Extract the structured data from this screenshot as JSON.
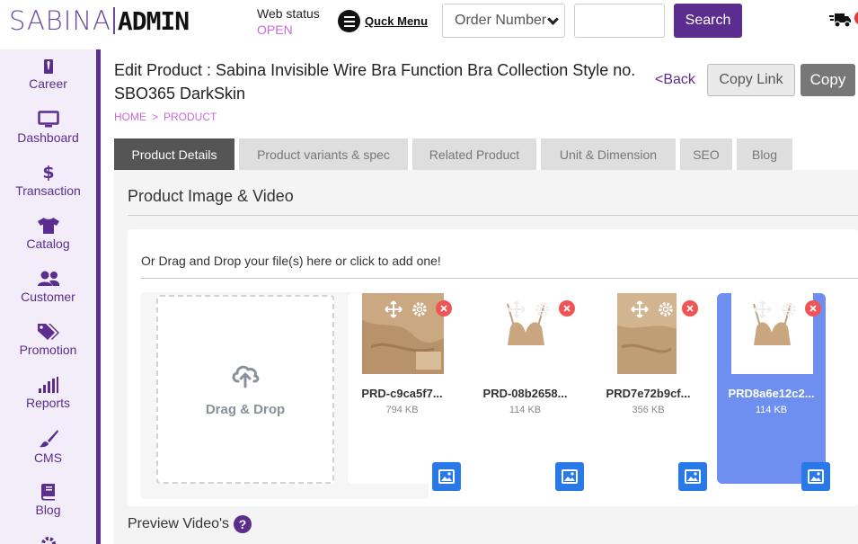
{
  "header": {
    "logo_left": "SABINA",
    "logo_right": "ADMIN",
    "web_status_label": "Web status",
    "web_status_value": "OPEN",
    "quick_menu_label": "Quck Menu",
    "order_select_value": "Order Number",
    "search_input_value": "",
    "search_button_label": "Search",
    "truck_icon": "truck-icon"
  },
  "sidebar": {
    "items": [
      {
        "label": "Career",
        "icon": "tie-icon"
      },
      {
        "label": "Dashboard",
        "icon": "monitor-icon"
      },
      {
        "label": "Transaction",
        "icon": "dollar-icon"
      },
      {
        "label": "Catalog",
        "icon": "shirt-icon"
      },
      {
        "label": "Customer",
        "icon": "users-icon"
      },
      {
        "label": "Promotion",
        "icon": "tags-icon"
      },
      {
        "label": "Reports",
        "icon": "signal-icon"
      },
      {
        "label": "CMS",
        "icon": "brush-icon"
      },
      {
        "label": "Blog",
        "icon": "book-icon"
      }
    ]
  },
  "page": {
    "title": "Edit Product : Sabina Invisible Wire Bra Function Bra Collection Style no. SBO365 DarkSkin",
    "back_label": "<Back",
    "copy_link_label": "Copy Link",
    "copy_label": "Copy",
    "breadcrumb": [
      "HOME",
      "PRODUCT"
    ],
    "breadcrumb_sep": ">"
  },
  "tabs": [
    {
      "label": "Product Details",
      "active": true
    },
    {
      "label": "Product variants & spec",
      "active": false
    },
    {
      "label": "Related Product",
      "active": false
    },
    {
      "label": "Unit & Dimension",
      "active": false
    },
    {
      "label": "SEO",
      "active": false
    },
    {
      "label": "Blog",
      "active": false
    }
  ],
  "media": {
    "section_title": "Product Image & Video",
    "drop_hint": "Or Drag and Drop your file(s) here or click to add one!",
    "dropzone_label": "Drag & Drop",
    "files": [
      {
        "name": "PRD-c9ca5f7...",
        "size": "794 KB",
        "selected": false
      },
      {
        "name": "PRD-08b2658...",
        "size": "114 KB",
        "selected": false
      },
      {
        "name": "PRD7e72b9cf...",
        "size": "356 KB",
        "selected": false
      },
      {
        "name": "PRD8a6e12c2...",
        "size": "114 KB",
        "selected": true
      }
    ],
    "preview_title": "Preview Video's",
    "help_glyph": "?"
  },
  "colors": {
    "brand": "#5b2d8e",
    "accent_pink": "#c86bd6",
    "selected_card": "#6e8ff0",
    "image_button": "#2979e8",
    "delete": "#f05454"
  }
}
